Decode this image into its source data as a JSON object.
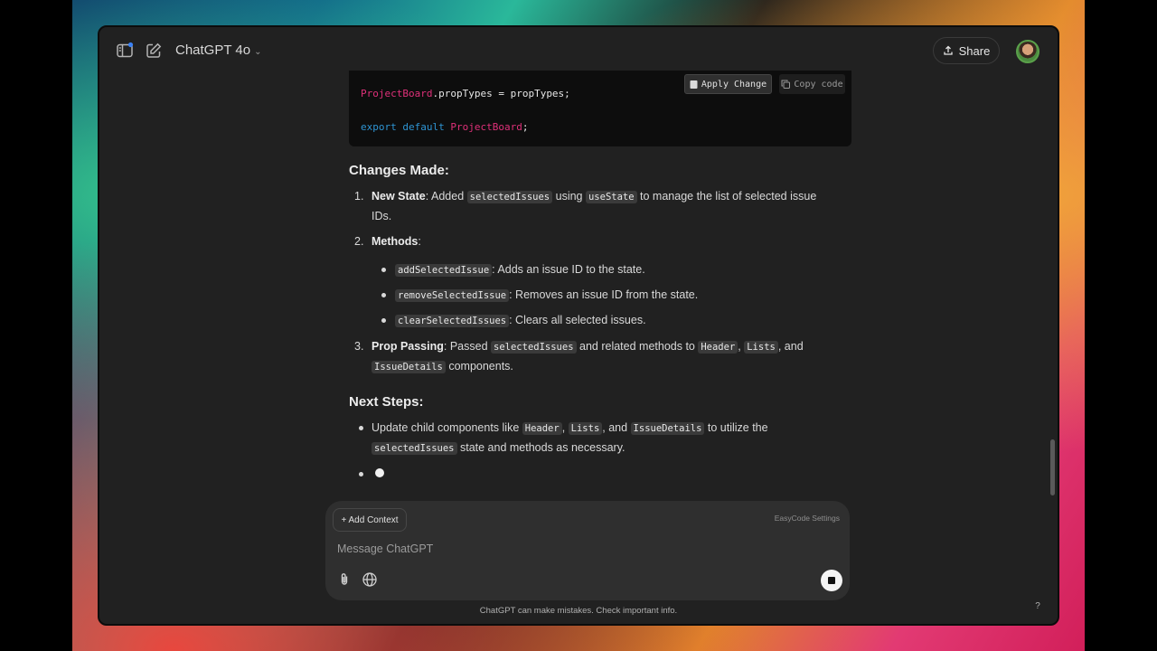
{
  "header": {
    "model_title": "ChatGPT 4o",
    "share_label": "Share"
  },
  "code": {
    "line1_component": "ProjectBoard",
    "line1_rest": ".propTypes = propTypes;",
    "line2_kw1": "export",
    "line2_kw2": "default",
    "line2_component": "ProjectBoard",
    "line2_end": ";",
    "apply_change_label": "Apply Change",
    "copy_code_label": "Copy code"
  },
  "changes": {
    "heading": "Changes Made:",
    "item1": {
      "num": "1.",
      "title": "New State",
      "t1": ": Added ",
      "c1": "selectedIssues",
      "t2": " using ",
      "c2": "useState",
      "t3": " to manage the list of selected issue",
      "t4": "IDs."
    },
    "item2": {
      "num": "2.",
      "title": "Methods",
      "t1": ":",
      "sub": [
        {
          "code": "addSelectedIssue",
          "text": ": Adds an issue ID to the state."
        },
        {
          "code": "removeSelectedIssue",
          "text": ": Removes an issue ID from the state."
        },
        {
          "code": "clearSelectedIssues",
          "text": ": Clears all selected issues."
        }
      ]
    },
    "item3": {
      "num": "3.",
      "title": "Prop Passing",
      "t1": ": Passed ",
      "c1": "selectedIssues",
      "t2": " and related methods to ",
      "c2": "Header",
      "t3": ", ",
      "c3": "Lists",
      "t4": ", and",
      "c4": "IssueDetails",
      "t5": " components."
    }
  },
  "next_steps": {
    "heading": "Next Steps:",
    "item1": {
      "t1": "Update child components like ",
      "c1": "Header",
      "t2": ", ",
      "c2": "Lists",
      "t3": ", and ",
      "c3": "IssueDetails",
      "t4": " to utilize the",
      "c4": "selectedIssues",
      "t5": " state and methods as necessary."
    }
  },
  "composer": {
    "add_context_label": "+ Add Context",
    "easycode_label": "EasyCode Settings",
    "placeholder": "Message ChatGPT"
  },
  "footer": {
    "disclaimer": "ChatGPT can make mistakes. Check important info.",
    "help_label": "?"
  }
}
